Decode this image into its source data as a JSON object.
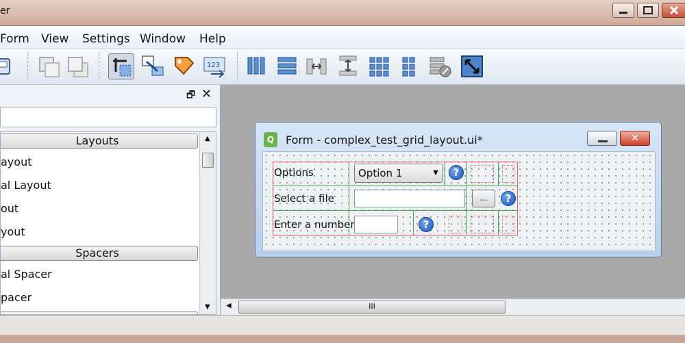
{
  "window": {
    "title_fragment": "er"
  },
  "menu": [
    "Form",
    "View",
    "Settings",
    "Window",
    "Help"
  ],
  "toolbar": {
    "icons": [
      "open-form-icon",
      "bring-to-front-icon",
      "send-to-back-icon",
      "edit-widgets-icon",
      "edit-signals-slots-icon",
      "edit-buddies-icon",
      "edit-tab-order-icon",
      "lay-out-horizontally-icon",
      "lay-out-vertically-icon",
      "lay-out-horizontal-splitter-icon",
      "lay-out-vertical-splitter-icon",
      "lay-out-grid-icon",
      "lay-out-form-icon",
      "break-layout-icon",
      "adjust-size-icon"
    ]
  },
  "widget_box": {
    "categories": [
      "Layouts",
      "Spacers"
    ],
    "layout_items": [
      "ayout",
      "al Layout",
      "out",
      "yout"
    ],
    "spacer_items": [
      "al Spacer",
      "pacer"
    ]
  },
  "form": {
    "title": "Form - complex_test_grid_layout.ui*",
    "close_glyph": "✕",
    "rows": [
      {
        "label": "Options",
        "combo_value": "Option 1"
      },
      {
        "label": "Select a file",
        "browse_label": "..."
      },
      {
        "label": "Enter a number"
      }
    ],
    "help_glyph": "?"
  },
  "scrollbar": {
    "grip": "III"
  }
}
